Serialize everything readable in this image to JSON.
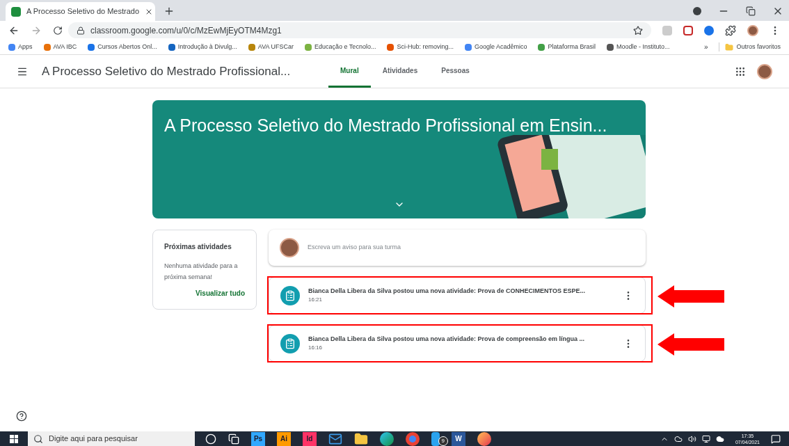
{
  "browser": {
    "tab": {
      "title": "A Processo Seletivo do Mestrado",
      "selected": true
    },
    "url": "classroom.google.com/u/0/c/MzEwMjEyOTM4Mzg1",
    "bookmarks": [
      {
        "label": "Apps",
        "color": "#4285f4"
      },
      {
        "label": "AVA IBC",
        "color": "#e8710a"
      },
      {
        "label": "Cursos Abertos Onl...",
        "color": "#1a73e8"
      },
      {
        "label": "Introdução à Divulg...",
        "color": "#1565c0"
      },
      {
        "label": "AVA UFSCar",
        "color": "#b8860b"
      },
      {
        "label": "Educação e Tecnolo...",
        "color": "#7cb342"
      },
      {
        "label": "Sci-Hub: removing...",
        "color": "#e65100"
      },
      {
        "label": "Google Acadêmico",
        "color": "#4285f4"
      },
      {
        "label": "Plataforma Brasil",
        "color": "#43a047"
      },
      {
        "label": "Moodle - Instituto...",
        "color": "#555555"
      }
    ],
    "more_bookmarks": "»",
    "other_bookmarks": "Outros favoritos"
  },
  "header": {
    "class_title": "A Processo Seletivo do Mestrado Profissional...",
    "tabs": [
      {
        "label": "Mural",
        "selected": true
      },
      {
        "label": "Atividades",
        "selected": false
      },
      {
        "label": "Pessoas",
        "selected": false
      }
    ]
  },
  "banner": {
    "title": "A Processo Seletivo do Mestrado Profissional em Ensin..."
  },
  "upcoming": {
    "title": "Próximas atividades",
    "message": "Nenhuma atividade para a próxima semana!",
    "link": "Visualizar tudo"
  },
  "composer": {
    "placeholder": "Escreva um aviso para sua turma"
  },
  "posts": [
    {
      "text": "Bianca Della Libera da Silva postou uma nova atividade: Prova de CONHECIMENTOS ESPE...",
      "time": "16:21",
      "highlighted": true
    },
    {
      "text": "Bianca Della Libera da Silva postou uma nova atividade: Prova de compreensão em língua ...",
      "time": "16:16",
      "highlighted": true
    }
  ],
  "taskbar": {
    "search_placeholder": "Digite aqui para pesquisar",
    "apps": [
      {
        "kind": "cortana"
      },
      {
        "kind": "taskview"
      },
      {
        "kind": "label",
        "label": "Ps",
        "color": "#31a8ff"
      },
      {
        "kind": "label",
        "label": "Ai",
        "color": "#ff9a00"
      },
      {
        "kind": "label",
        "label": "Id",
        "color": "#ff3366"
      },
      {
        "kind": "mail"
      },
      {
        "kind": "folder"
      },
      {
        "kind": "edge"
      },
      {
        "kind": "chrome"
      },
      {
        "kind": "phone",
        "badge": "9"
      },
      {
        "kind": "word",
        "label": "W"
      },
      {
        "kind": "firefox"
      }
    ],
    "time": "17:35",
    "date": "07/04/2021"
  }
}
